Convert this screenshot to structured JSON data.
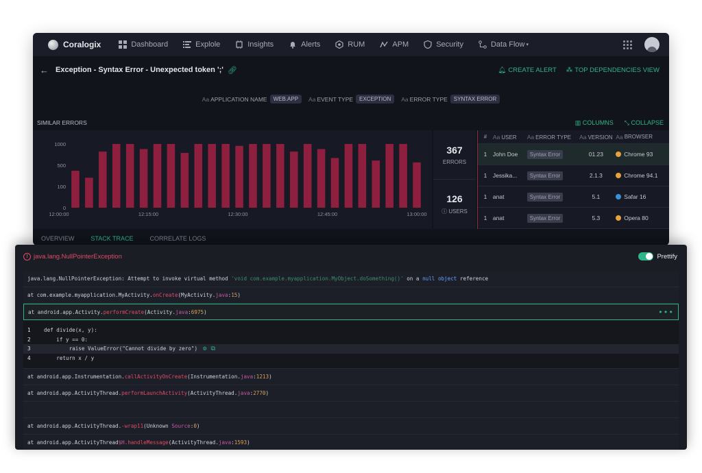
{
  "nav": {
    "brand": "Coralogix",
    "items": [
      {
        "label": "Dashboard",
        "icon": "dashboard-icon"
      },
      {
        "label": "Explole",
        "icon": "explore-icon"
      },
      {
        "label": "Insights",
        "icon": "insights-icon"
      },
      {
        "label": "Alerts",
        "icon": "bell-icon"
      },
      {
        "label": "RUM",
        "icon": "rum-icon"
      },
      {
        "label": "APM",
        "icon": "apm-icon"
      },
      {
        "label": "Security",
        "icon": "shield-icon"
      },
      {
        "label": "Data Flow",
        "icon": "data-flow-icon"
      }
    ]
  },
  "header": {
    "title": "Exception - Syntax Error - Unexpected token ';'",
    "create_alert": "CREATE ALERT",
    "top_dependencies": "TOP DEPENDENCIES VIEW"
  },
  "filters": [
    {
      "label": "APPLICATION NAME",
      "value": "WEB.APP"
    },
    {
      "label": "EVENT TYPE",
      "value": "EXCEPTION"
    },
    {
      "label": "ERROR TYPE",
      "value": "SYNTAX ERROR"
    }
  ],
  "similar": {
    "label": "SIMILAR ERRORS",
    "columns": "COLUMNS",
    "collapse": "COLLAPSE"
  },
  "stats": {
    "errors_count": "367",
    "errors_label": "ERRORS",
    "users_count": "126",
    "users_label": "USERS"
  },
  "chart_data": {
    "type": "bar",
    "title": "",
    "xlabel": "",
    "ylabel": "",
    "ylim": [
      0,
      1000
    ],
    "yticks": [
      "1000",
      "500",
      "100",
      "0"
    ],
    "xticks": [
      "12:00:00",
      "12:15:00",
      "12:30:00",
      "12:45:00",
      "13:00:00"
    ],
    "values": [
      580,
      470,
      880,
      1000,
      1000,
      920,
      1000,
      1000,
      860,
      1000,
      1000,
      1000,
      970,
      1000,
      1000,
      1000,
      880,
      1000,
      920,
      780,
      1000,
      1000,
      740,
      1000,
      1000,
      710
    ],
    "color": "#8e1f3e"
  },
  "table": {
    "headers": {
      "num": "#",
      "user": "USER",
      "error_type": "ERROR TYPE",
      "version": "VERSION",
      "browser": "BROWSER"
    },
    "rows": [
      {
        "n": "1",
        "user": "John Doe",
        "error": "Syntax Error",
        "version": "01.23",
        "browser": "Chrome 93",
        "dot": "#e9a23b"
      },
      {
        "n": "1",
        "user": "Jessika...",
        "error": "Syntax Error",
        "version": "2.1.3",
        "browser": "Chrome 94.1",
        "dot": "#e9a23b"
      },
      {
        "n": "1",
        "user": "anat",
        "error": "Syntax Error",
        "version": "5.1",
        "browser": "Safar 16",
        "dot": "#3b8fd9"
      },
      {
        "n": "1",
        "user": "anat",
        "error": "Syntax Error",
        "version": "5.3",
        "browser": "Opera 80",
        "dot": "#e9a23b"
      }
    ]
  },
  "tabs": [
    "OVERVIEW",
    "STACK TRACE",
    "CORRELATE LOGS"
  ],
  "trace": {
    "exception": "java.lang.NullPointerException",
    "prettify": "Prettify",
    "line1": {
      "a": "java.lang.NullPointerException: Attempt to invoke virtual method ",
      "b": "'void com.example.myapplication.MyObject.doSomething()'",
      "c": " on a ",
      "d": "null",
      "e": " ",
      "f": "object",
      "g": " reference"
    },
    "line2": {
      "a": "at com.example.myapplication.MyActivity.",
      "fn": "onCreate",
      "b": "(MyActivity.",
      "ext": "java",
      "c": ":",
      "num": "15",
      "d": ")"
    },
    "line3": {
      "a": "at android.app.Activity.",
      "fn": "performCreate",
      "b": "(Activity.",
      "ext": "java",
      "c": ":",
      "num": "6975",
      "d": ")"
    },
    "code": [
      {
        "n": "1",
        "text": "def divide(x, y):"
      },
      {
        "n": "2",
        "text": "    if y == 0:"
      },
      {
        "n": "3",
        "text": "        raise ValueError(\"Cannot divide by zero\")"
      },
      {
        "n": "4",
        "text": "    return x / y"
      }
    ],
    "line4": {
      "a": "at android.app.Instrumentation.",
      "fn": "callActivityOnCreate",
      "b": "(Instrumentation.",
      "ext": "java",
      "c": ":",
      "num": "1213",
      "d": ")"
    },
    "line5": {
      "a": "at android.app.ActivityThread.",
      "fn": "performLaunchActivity",
      "b": "(ActivityThread.",
      "ext": "java",
      "c": ":",
      "num": "2770",
      "d": ")"
    },
    "line6": {
      "a": "at android.app.ActivityThread.",
      "fn": "-wrap11",
      "b": "(Unknown ",
      "src": "Source",
      "c": ":",
      "num": "0",
      "d": ")"
    },
    "line7": {
      "a": "at android.app.ActivityThread",
      "pk": "$H.",
      "fn": "handleMessage",
      "b": "(ActivityThread.",
      "ext": "java",
      "c": ":",
      "num": "1593",
      "d": ")"
    }
  }
}
